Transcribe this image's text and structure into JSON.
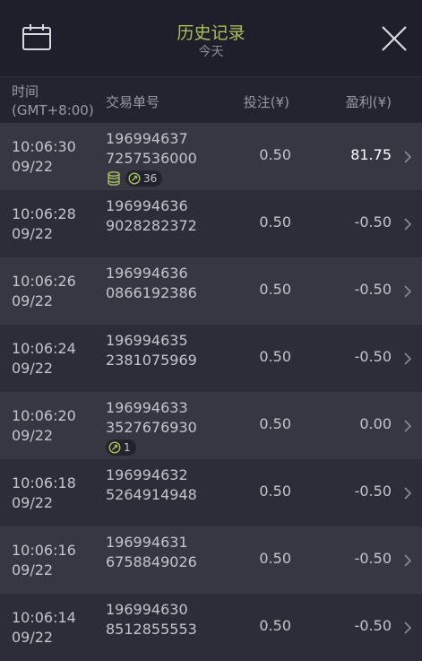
{
  "header": {
    "title": "历史记录",
    "subtitle": "今天"
  },
  "columns": {
    "time_line1": "时间",
    "time_line2": "(GMT+8:00)",
    "order": "交易单号",
    "bet": "投注(¥)",
    "profit": "盈利(¥)"
  },
  "rows": [
    {
      "time": "10:06:30",
      "date": "09/22",
      "order1": "196994637",
      "order2": "7257536000",
      "bet": "0.50",
      "profit": "81.75",
      "badges": {
        "coins": true,
        "count": "36"
      }
    },
    {
      "time": "10:06:28",
      "date": "09/22",
      "order1": "196994636",
      "order2": "9028282372",
      "bet": "0.50",
      "profit": "-0.50"
    },
    {
      "time": "10:06:26",
      "date": "09/22",
      "order1": "196994636",
      "order2": "0866192386",
      "bet": "0.50",
      "profit": "-0.50"
    },
    {
      "time": "10:06:24",
      "date": "09/22",
      "order1": "196994635",
      "order2": "2381075969",
      "bet": "0.50",
      "profit": "-0.50"
    },
    {
      "time": "10:06:20",
      "date": "09/22",
      "order1": "196994633",
      "order2": "3527676930",
      "bet": "0.50",
      "profit": "0.00",
      "badges": {
        "coins": false,
        "count": "1"
      }
    },
    {
      "time": "10:06:18",
      "date": "09/22",
      "order1": "196994632",
      "order2": "5264914948",
      "bet": "0.50",
      "profit": "-0.50"
    },
    {
      "time": "10:06:16",
      "date": "09/22",
      "order1": "196994631",
      "order2": "6758849026",
      "bet": "0.50",
      "profit": "-0.50"
    },
    {
      "time": "10:06:14",
      "date": "09/22",
      "order1": "196994630",
      "order2": "8512855553",
      "bet": "0.50",
      "profit": "-0.50"
    }
  ],
  "colors": {
    "title": "#a6c15b",
    "header_bg": "#1f1f2b",
    "row_odd": "#373744",
    "row_even": "#2d2d3a",
    "win_profit": "#ffffff",
    "badge_icon": "#a6c15b"
  },
  "icons": {
    "calendar": "calendar-icon",
    "close": "close-icon",
    "row_arrow": "chevron-right-icon",
    "coins": "coins-icon",
    "free_spin": "free-spin-icon"
  }
}
